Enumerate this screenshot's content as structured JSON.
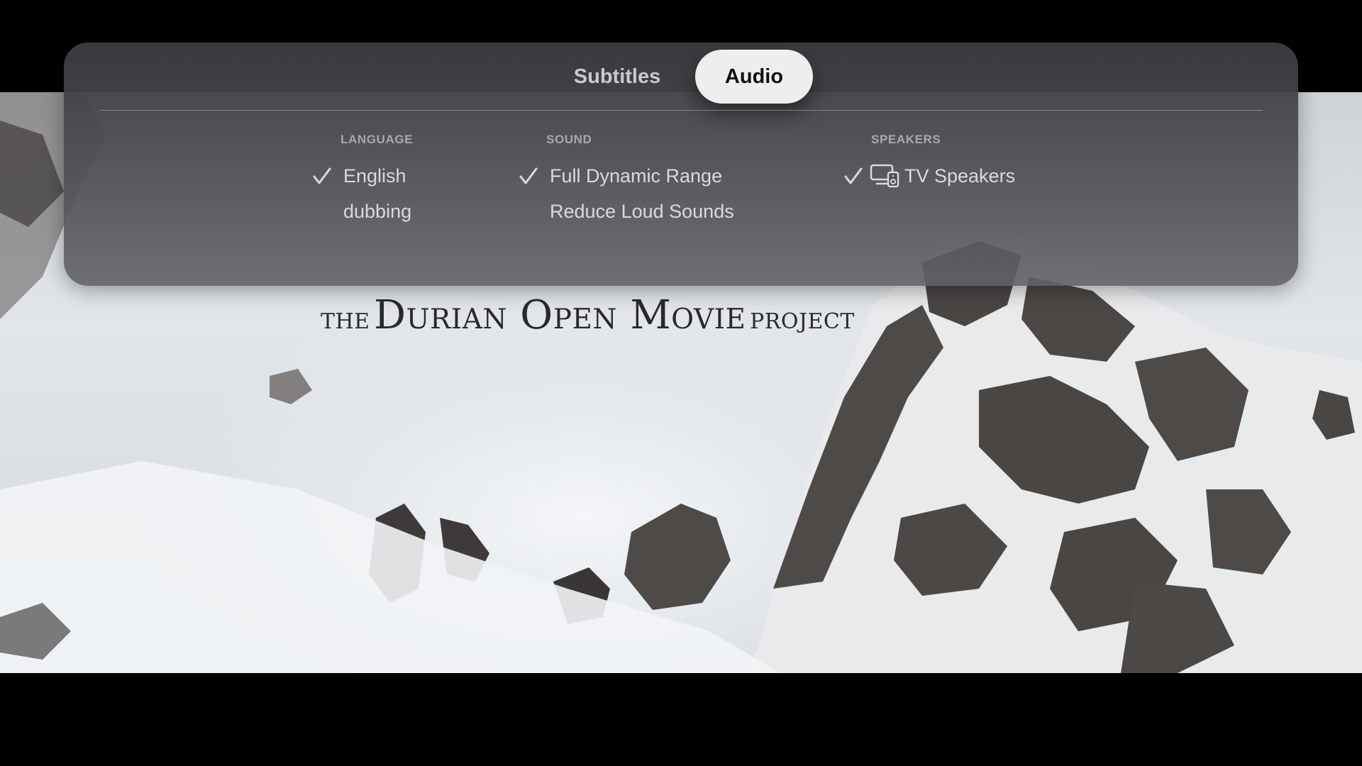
{
  "tabs": {
    "subtitles_label": "Subtitles",
    "audio_label": "Audio",
    "selected": "Audio"
  },
  "language": {
    "heading": "LANGUAGE",
    "options": [
      {
        "label": "English",
        "selected": true
      },
      {
        "label": "dubbing",
        "selected": false
      }
    ]
  },
  "sound": {
    "heading": "SOUND",
    "options": [
      {
        "label": "Full Dynamic Range",
        "selected": true
      },
      {
        "label": "Reduce Loud Sounds",
        "selected": false
      }
    ]
  },
  "speakers": {
    "heading": "SPEAKERS",
    "options": [
      {
        "label": "TV Speakers",
        "selected": true,
        "icon": "tv-speaker-icon"
      }
    ]
  },
  "video": {
    "title_the": "The",
    "title_main": "Durian Open Movie",
    "title_project": "project"
  },
  "colors": {
    "panel": "#4a4c50",
    "selected_tab_bg": "#eeeeef",
    "heading": "#a8a9ad",
    "option_text": "#d9dadc"
  }
}
